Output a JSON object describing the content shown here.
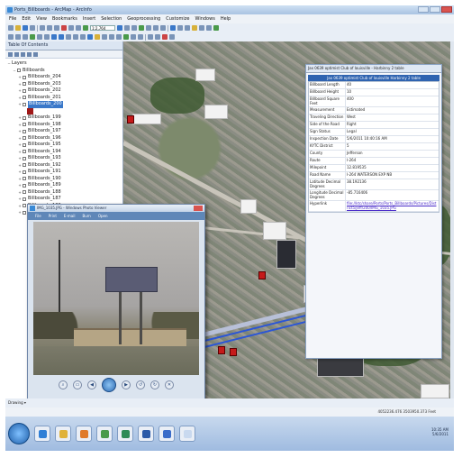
{
  "window": {
    "title": "Ports_Billboards - ArcMap - ArcInfo"
  },
  "menu": [
    "File",
    "Edit",
    "View",
    "Bookmarks",
    "Insert",
    "Selection",
    "Geoprocessing",
    "Customize",
    "Windows",
    "Help"
  ],
  "toolbar": {
    "scale": "1:2,764"
  },
  "toc": {
    "title": "Table Of Contents",
    "layers_label": "Layers",
    "group_label": "Billboards",
    "items": [
      {
        "label": "Billboards_204",
        "selected": false
      },
      {
        "label": "Billboards_203",
        "selected": false
      },
      {
        "label": "Billboards_202",
        "selected": false
      },
      {
        "label": "Billboards_201",
        "selected": false
      },
      {
        "label": "Billboards_200",
        "selected": true
      },
      {
        "label": "Billboards_199",
        "selected": false
      },
      {
        "label": "Billboards_198",
        "selected": false
      },
      {
        "label": "Billboards_197",
        "selected": false
      },
      {
        "label": "Billboards_196",
        "selected": false
      },
      {
        "label": "Billboards_195",
        "selected": false
      },
      {
        "label": "Billboards_194",
        "selected": false
      },
      {
        "label": "Billboards_193",
        "selected": false
      },
      {
        "label": "Billboards_192",
        "selected": false
      },
      {
        "label": "Billboards_191",
        "selected": false
      },
      {
        "label": "Billboards_190",
        "selected": false
      },
      {
        "label": "Billboards_189",
        "selected": false
      },
      {
        "label": "Billboards_188",
        "selected": false
      },
      {
        "label": "Billboards_187",
        "selected": false
      },
      {
        "label": "Billboards_186",
        "selected": false
      },
      {
        "label": "Billboards_185",
        "selected": false
      }
    ],
    "swatch_color": "#a01818"
  },
  "identify": {
    "title": "Jax 0639 optimist Club of louisville - Harbinny 2 table",
    "header": "Jax 0639 optimist Club of louisville Harbinny 2 table",
    "rows": [
      {
        "k": "Billboard Length",
        "v": "40"
      },
      {
        "k": "Billboard Height",
        "v": "10"
      },
      {
        "k": "Billboard Square Feet",
        "v": "400"
      },
      {
        "k": "Measurement",
        "v": "Estimated"
      },
      {
        "k": "Traveling Direction",
        "v": "West"
      },
      {
        "k": "Side of the Road",
        "v": "Right"
      },
      {
        "k": "Sign Status",
        "v": "Legal"
      },
      {
        "k": "Inspection Date",
        "v": "5/6/2011 10:40:16 AM"
      },
      {
        "k": "KYTC District",
        "v": "5"
      },
      {
        "k": "County",
        "v": "Jefferson"
      },
      {
        "k": "Route",
        "v": "I-264"
      },
      {
        "k": "Milepoint",
        "v": "12.819535"
      },
      {
        "k": "Road Name",
        "v": "I-264 WATERSON EXP NB"
      },
      {
        "k": "Latitude Decimal Degrees",
        "v": "38.192136"
      },
      {
        "k": "Longitude Decimal Degrees",
        "v": "-85.716406"
      },
      {
        "k": "Hyperlink",
        "v": "file://ktc/share/Ports/Ports_Billboards/Pictures/District5/jeff/200/IMG_1035.JPG",
        "link": true
      }
    ]
  },
  "photo": {
    "title": "IMG_1035.JPG - Windows Photo Viewer",
    "menu": [
      "File",
      "Print",
      "E-mail",
      "Burn",
      "Open"
    ]
  },
  "drawing": {
    "label": "Drawing ▾"
  },
  "status": {
    "coords": "4052236.476  3503950.373 Feet"
  },
  "taskbar": {
    "time": "10:35 AM",
    "date": "5/6/2011"
  },
  "colors": {
    "selection": "#3a78c9",
    "marker": "#c51a1a",
    "link": "#4a2cc9"
  }
}
